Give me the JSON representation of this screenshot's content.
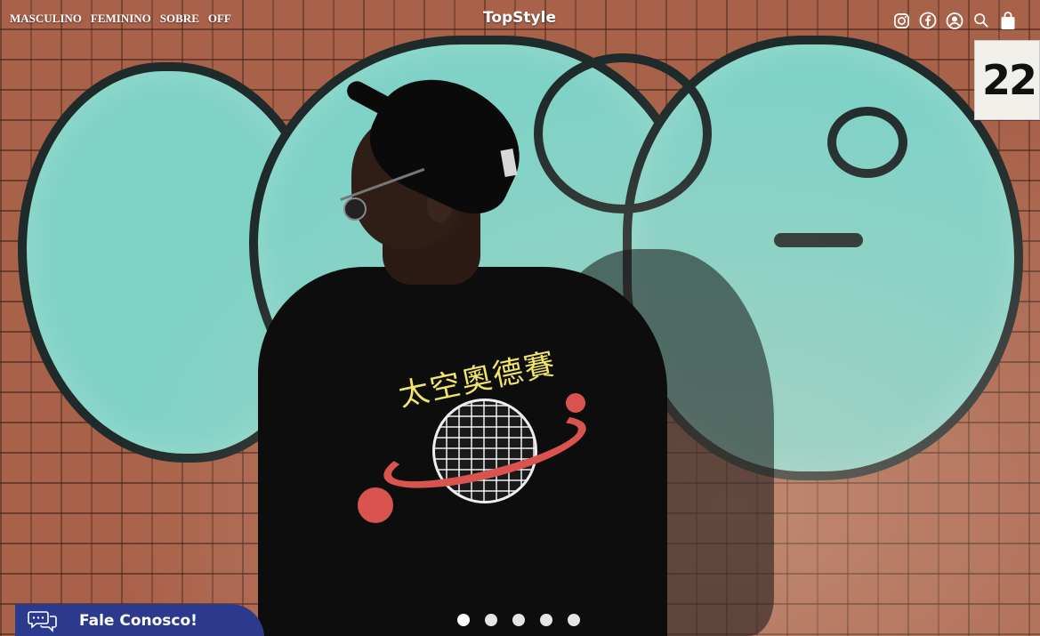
{
  "nav": {
    "items": [
      {
        "label": "MASCULINO"
      },
      {
        "label": "FEMININO"
      },
      {
        "label": "SOBRE"
      },
      {
        "label": "OFF"
      }
    ]
  },
  "brand": {
    "name": "TopStyle"
  },
  "header_icons": [
    "instagram-icon",
    "facebook-icon",
    "user-account-icon",
    "search-icon",
    "shopping-bag-icon"
  ],
  "hero": {
    "wall_number": "22",
    "shirt_text": "太空奧德賽"
  },
  "contact": {
    "label": "Fale Conosco!",
    "icon": "chat-bubbles-icon",
    "color": "#2b3a8c"
  },
  "carousel": {
    "slide_count": 5,
    "active_index": 0
  }
}
